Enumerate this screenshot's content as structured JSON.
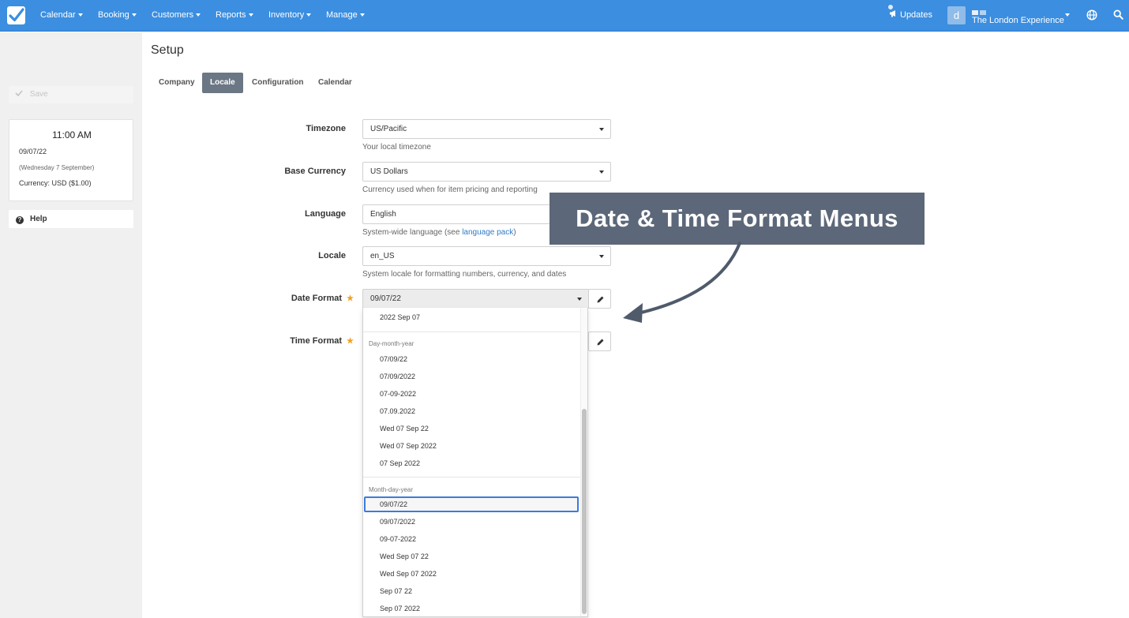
{
  "nav": {
    "items": [
      {
        "label": "Calendar"
      },
      {
        "label": "Booking"
      },
      {
        "label": "Customers"
      },
      {
        "label": "Reports"
      },
      {
        "label": "Inventory"
      },
      {
        "label": "Manage"
      }
    ],
    "updates_label": "Updates",
    "avatar_letter": "d",
    "account_name": "The London Experience",
    "brand_color": "#3b8ee0"
  },
  "sidebar": {
    "save_label": "Save",
    "clock": {
      "time": "11:00 AM",
      "date": "09/07/22",
      "day": "(Wednesday 7 September)",
      "currency": "Currency: USD ($1.00)"
    },
    "help_label": "Help"
  },
  "main": {
    "title": "Setup",
    "tabs": [
      {
        "label": "Company",
        "active": false
      },
      {
        "label": "Locale",
        "active": true
      },
      {
        "label": "Configuration",
        "active": false
      },
      {
        "label": "Calendar",
        "active": false
      }
    ],
    "fields": {
      "timezone": {
        "label": "Timezone",
        "value": "US/Pacific",
        "help": "Your local timezone"
      },
      "currency": {
        "label": "Base Currency",
        "value": "US Dollars",
        "help": "Currency used when for item pricing and reporting"
      },
      "language": {
        "label": "Language",
        "value": "English",
        "help_prefix": "System-wide language (see ",
        "help_link": "language pack",
        "help_suffix": ")"
      },
      "locale": {
        "label": "Locale",
        "value": "en_US",
        "help": "System locale for formatting numbers, currency, and dates"
      },
      "date_format": {
        "label": "Date Format",
        "value": "09/07/22",
        "required": true
      },
      "time_format": {
        "label": "Time Format",
        "required": true
      }
    }
  },
  "date_format_dropdown": {
    "top_partial_option": "2022 Sep 07",
    "groups": [
      {
        "label": "Day-month-year",
        "options": [
          "07/09/22",
          "07/09/2022",
          "07-09-2022",
          "07.09.2022",
          "Wed 07 Sep 22",
          "Wed 07 Sep 2022",
          "07 Sep 2022"
        ]
      },
      {
        "label": "Month-day-year",
        "options": [
          "09/07/22",
          "09/07/2022",
          "09-07-2022",
          "Wed Sep 07 22",
          "Wed Sep 07 2022",
          "Sep 07 22",
          "Sep 07 2022"
        ]
      }
    ],
    "selected": "09/07/22"
  },
  "annotation": {
    "callout_text": "Date & Time Format Menus",
    "callout_color": "#5c6879"
  }
}
